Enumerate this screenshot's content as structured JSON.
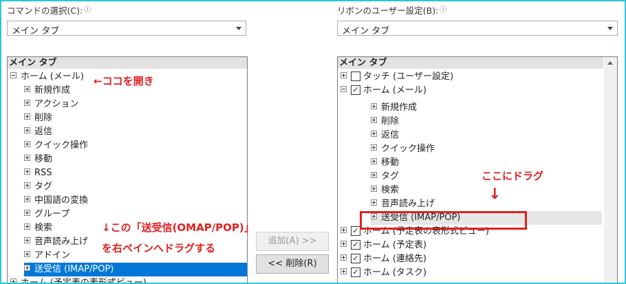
{
  "left": {
    "label": "コマンドの選択(C):",
    "info": "ⓘ",
    "combo_value": "メイン タブ",
    "list_header": "メイン タブ",
    "rows": [
      {
        "text": "ホーム (メール)",
        "indent": 0,
        "icon": "minus"
      },
      {
        "text": "新規作成",
        "indent": 1,
        "icon": "plus"
      },
      {
        "text": "アクション",
        "indent": 1,
        "icon": "plus"
      },
      {
        "text": "削除",
        "indent": 1,
        "icon": "plus"
      },
      {
        "text": "返信",
        "indent": 1,
        "icon": "plus"
      },
      {
        "text": "クイック操作",
        "indent": 1,
        "icon": "plus"
      },
      {
        "text": "移動",
        "indent": 1,
        "icon": "plus"
      },
      {
        "text": "RSS",
        "indent": 1,
        "icon": "plus"
      },
      {
        "text": "タグ",
        "indent": 1,
        "icon": "plus"
      },
      {
        "text": "中国語の変換",
        "indent": 1,
        "icon": "plus"
      },
      {
        "text": "グループ",
        "indent": 1,
        "icon": "plus"
      },
      {
        "text": "検索",
        "indent": 1,
        "icon": "plus"
      },
      {
        "text": "音声読み上げ",
        "indent": 1,
        "icon": "plus"
      },
      {
        "text": "アドイン",
        "indent": 1,
        "icon": "plus"
      },
      {
        "text": "送受信 (IMAP/POP)",
        "indent": 1,
        "icon": "plus",
        "selected": true
      },
      {
        "text": "ホーム (予定表の表形式ビュー)",
        "indent": 0,
        "icon": "plus"
      }
    ]
  },
  "right": {
    "label": "リボンのユーザー設定(B):",
    "info": "ⓘ",
    "combo_value": "メイン タブ",
    "list_header": "メイン タブ",
    "rows": [
      {
        "text": "タッチ (ユーザー設定)",
        "indent": 0,
        "icon": "plus",
        "checkbox": false
      },
      {
        "text": "ホーム (メール)",
        "indent": 0,
        "icon": "minus",
        "checkbox": true
      },
      {
        "text": "新規作成",
        "indent": 2,
        "icon": "plus"
      },
      {
        "text": "削除",
        "indent": 2,
        "icon": "plus"
      },
      {
        "text": "返信",
        "indent": 2,
        "icon": "plus"
      },
      {
        "text": "クイック操作",
        "indent": 2,
        "icon": "plus"
      },
      {
        "text": "移動",
        "indent": 2,
        "icon": "plus"
      },
      {
        "text": "タグ",
        "indent": 2,
        "icon": "plus"
      },
      {
        "text": "検索",
        "indent": 2,
        "icon": "plus"
      },
      {
        "text": "音声読み上げ",
        "indent": 2,
        "icon": "plus"
      },
      {
        "text": "送受信 (IMAP/POP)",
        "indent": 2,
        "icon": "plus",
        "highlight": true
      },
      {
        "text": "ホーム (予定表の表形式ビュー)",
        "indent": 0,
        "icon": "plus",
        "checkbox": true
      },
      {
        "text": "ホーム (予定表)",
        "indent": 0,
        "icon": "plus",
        "checkbox": true
      },
      {
        "text": "ホーム (連絡先)",
        "indent": 0,
        "icon": "plus",
        "checkbox": true
      },
      {
        "text": "ホーム (タスク)",
        "indent": 0,
        "icon": "plus",
        "checkbox": true
      }
    ]
  },
  "buttons": {
    "add": "追加(A) >>",
    "remove": "<< 削除(R)"
  },
  "annotations": {
    "open_here": "←ココを開き",
    "drag_here": "ここにドラグ",
    "arrow": "↓",
    "instruction_line1": "↓この「送受信(OMAP/POP)」",
    "instruction_line2": "を右ペインへドラグする"
  },
  "colors": {
    "accent_frame": "#2ec5d8",
    "annotation": "#e02020",
    "selection": "#0078d7"
  }
}
